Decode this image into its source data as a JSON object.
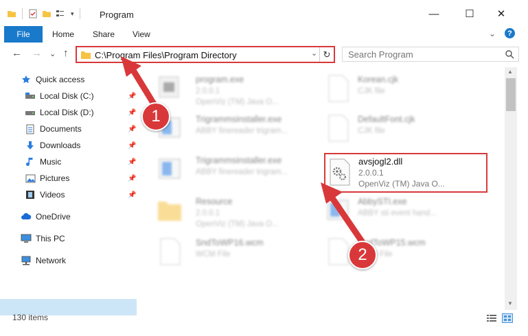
{
  "window": {
    "title": "Program",
    "minimize": "—",
    "maximize": "☐",
    "close": "✕"
  },
  "ribbon": {
    "file": "File",
    "home": "Home",
    "share": "Share",
    "view": "View",
    "collapse": "⌄",
    "help": "?"
  },
  "navigation": {
    "back": "←",
    "forward": "→",
    "recent": "⌄",
    "up": "↑",
    "address": "C:\\Program Files\\Program Directory",
    "address_dropdown": "⌄",
    "refresh": "↻",
    "search_placeholder": "Search Program"
  },
  "sidebar": {
    "quick_access": "Quick access",
    "items": [
      {
        "label": "Local Disk (C:)",
        "icon": "drive-icon",
        "pinned": true
      },
      {
        "label": "Local Disk (D:)",
        "icon": "drive-icon",
        "pinned": true
      },
      {
        "label": "Documents",
        "icon": "documents-icon",
        "pinned": true
      },
      {
        "label": "Downloads",
        "icon": "download-icon",
        "pinned": true
      },
      {
        "label": "Music",
        "icon": "music-icon",
        "pinned": true
      },
      {
        "label": "Pictures",
        "icon": "pictures-icon",
        "pinned": true
      },
      {
        "label": "Videos",
        "icon": "videos-icon",
        "pinned": true
      }
    ],
    "onedrive": "OneDrive",
    "this_pc": "This PC",
    "network": "Network"
  },
  "files": [
    {
      "name": "program.exe",
      "line2": "2.0.0.1",
      "line3": "OpenViz (TM) Java O..."
    },
    {
      "name": "Korean.cjk",
      "line2": "CJK file",
      "line3": ""
    },
    {
      "name": "Trigrammsinstaller.exe",
      "line2": "ABBY finereader trigram...",
      "line3": ""
    },
    {
      "name": "DefaultFont.cjk",
      "line2": "CJK file",
      "line3": ""
    },
    {
      "name": "Trigrammsinstaller.exe",
      "line2": "ABBY finereader trigram...",
      "line3": ""
    },
    {
      "name": "Resource",
      "line2": "2.0.0.1",
      "line3": "OpenViz (TM) Java O..."
    },
    {
      "name": "AbbySTI.exe",
      "line2": "ABBY sti event hand...",
      "line3": ""
    },
    {
      "name": "SndToWP16.wcm",
      "line2": "WCM File",
      "line3": ""
    },
    {
      "name": "SndToWP15.wcm",
      "line2": "WCM File",
      "line3": ""
    }
  ],
  "highlighted_file": {
    "name": "avsjogl2.dll",
    "line2": "2.0.0.1",
    "line3": "OpenViz (TM) Java O..."
  },
  "status": {
    "item_count": "130 items"
  },
  "annotations": {
    "step1": "1",
    "step2": "2",
    "color": "#d9383a"
  }
}
